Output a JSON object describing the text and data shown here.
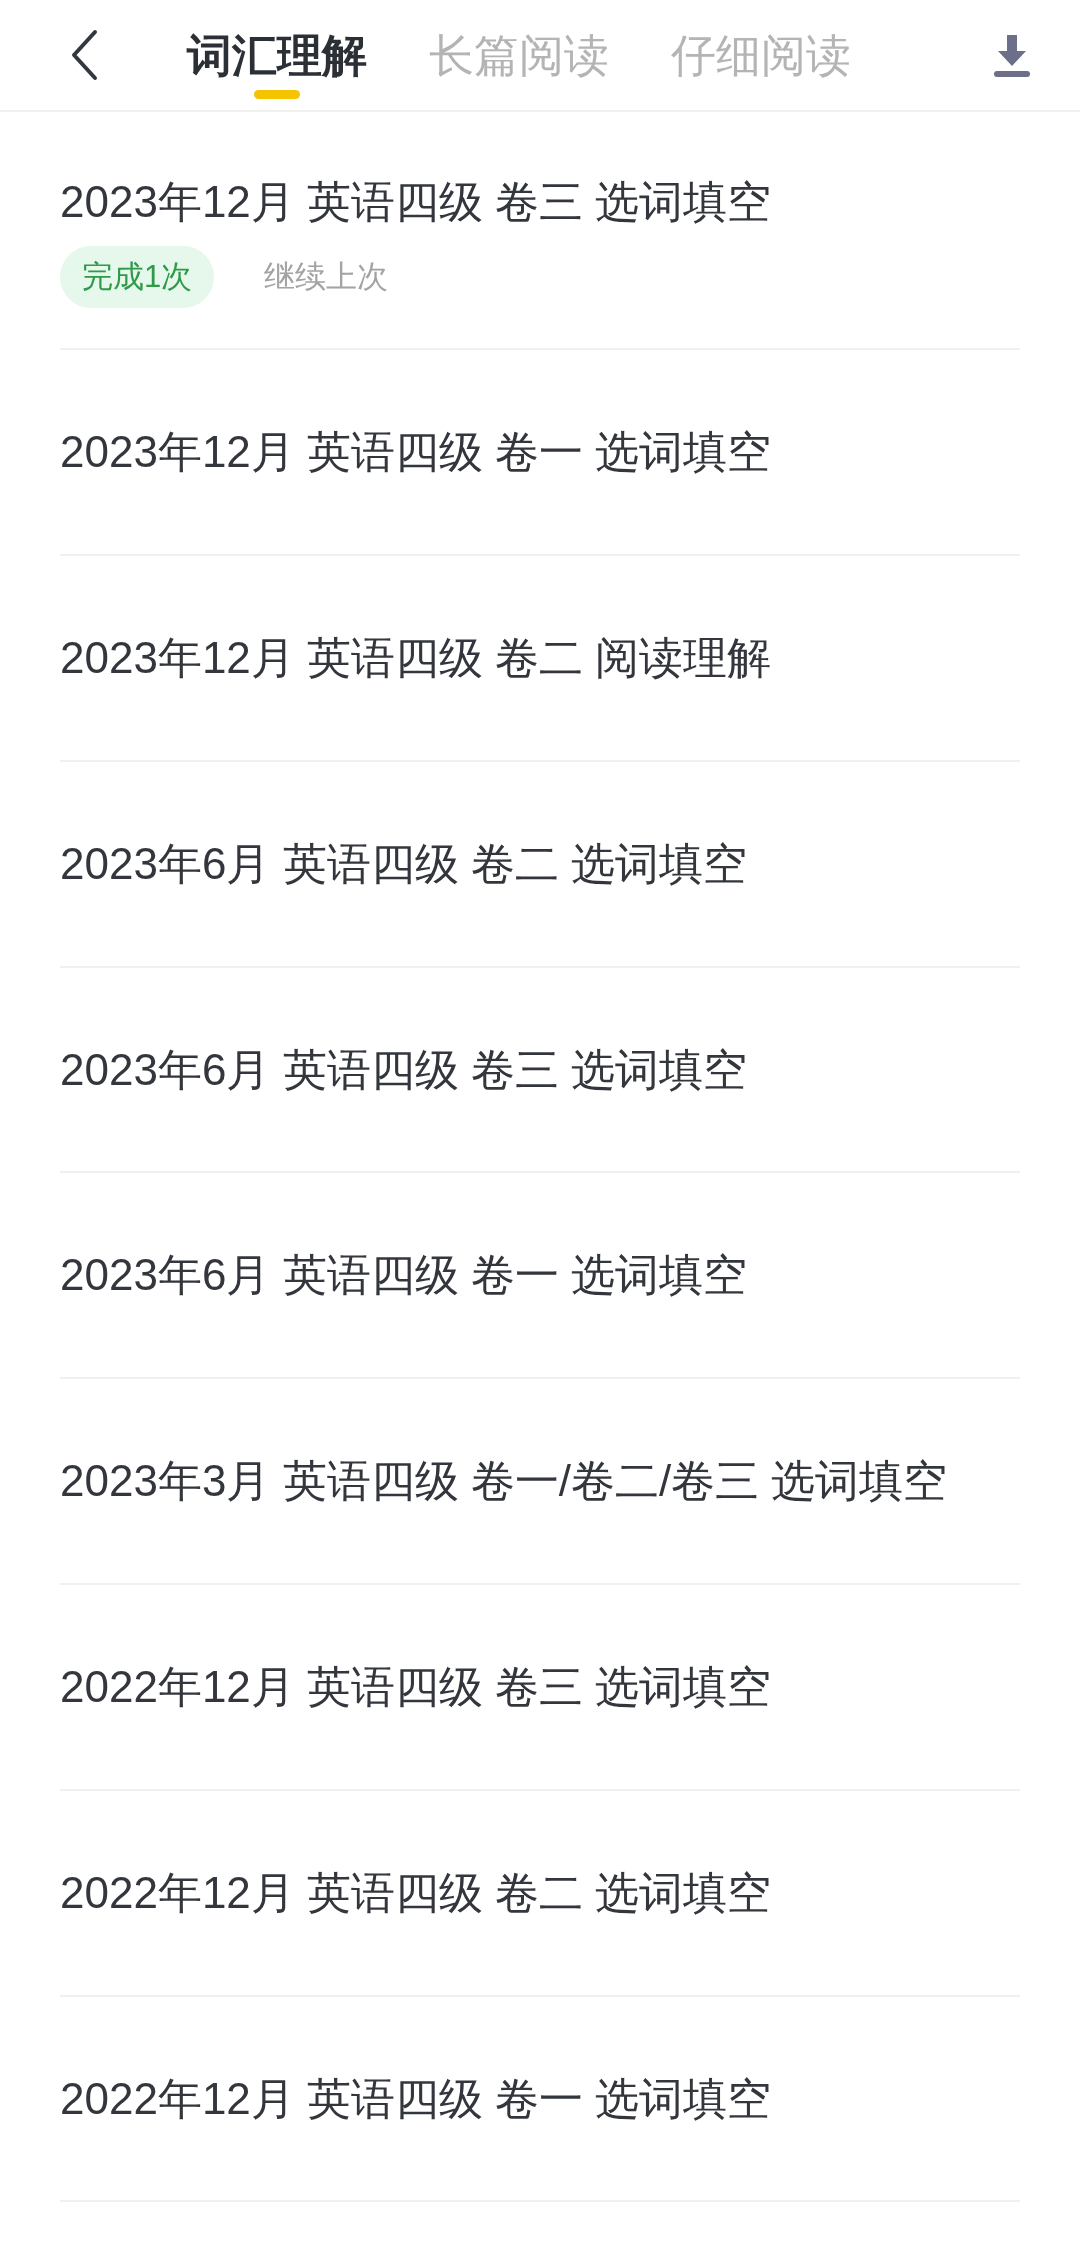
{
  "header": {
    "tabs": [
      {
        "label": "词汇理解",
        "selected": true
      },
      {
        "label": "长篇阅读",
        "selected": false
      },
      {
        "label": "仔细阅读",
        "selected": false
      }
    ]
  },
  "items": [
    {
      "title": "2023年12月 英语四级 卷三 选词填空",
      "tags": [
        {
          "kind": "count",
          "text": "完成1次"
        },
        {
          "kind": "link",
          "text": "继续上次"
        }
      ]
    },
    {
      "title": "2023年12月 英语四级 卷一 选词填空"
    },
    {
      "title": "2023年12月 英语四级 卷二 阅读理解"
    },
    {
      "title": "2023年6月 英语四级 卷二 选词填空"
    },
    {
      "title": "2023年6月 英语四级 卷三 选词填空"
    },
    {
      "title": "2023年6月 英语四级 卷一 选词填空"
    },
    {
      "title": "2023年3月 英语四级 卷一/卷二/卷三 选词填空"
    },
    {
      "title": "2022年12月 英语四级 卷三 选词填空"
    },
    {
      "title": "2022年12月 英语四级 卷二 选词填空"
    },
    {
      "title": "2022年12月 英语四级 卷一 选词填空"
    }
  ]
}
